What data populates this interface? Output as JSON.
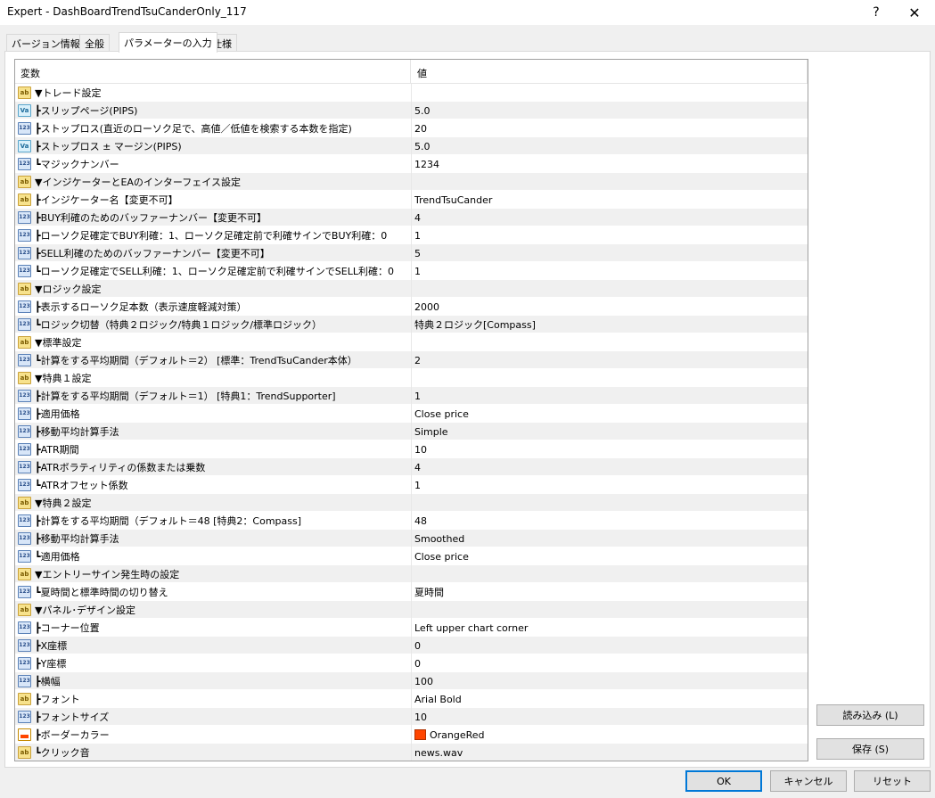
{
  "window": {
    "title": "Expert - DashBoardTrendTsuCanderOnly_117",
    "help_label": "?",
    "close_label": "✕"
  },
  "tabs": [
    {
      "label": "バージョン情報"
    },
    {
      "label": "全般"
    },
    {
      "label": "パラメーターの入力",
      "active": true
    },
    {
      "label": "仕様"
    }
  ],
  "grid": {
    "col_name": "変数",
    "col_value": "値",
    "rows": [
      {
        "icon": "ab",
        "name": "▼トレード設定",
        "value": ""
      },
      {
        "icon": "va",
        "name": "┣スリップページ(PIPS)",
        "value": "5.0"
      },
      {
        "icon": "123",
        "name": "┣ストップロス(直近のローソク足で、高値／低値を検索する本数を指定)",
        "value": "20"
      },
      {
        "icon": "va",
        "name": "┣ストップロス ± マージン(PIPS)",
        "value": "5.0"
      },
      {
        "icon": "123",
        "name": "┗マジックナンバー",
        "value": "1234"
      },
      {
        "icon": "ab",
        "name": "▼インジケーターとEAのインターフェイス設定",
        "value": ""
      },
      {
        "icon": "ab",
        "name": "┣インジケーター名【変更不可】",
        "value": "TrendTsuCander"
      },
      {
        "icon": "123",
        "name": "┣BUY利確のためのバッファーナンバー【変更不可】",
        "value": "4"
      },
      {
        "icon": "123",
        "name": "┣ローソク足確定でBUY利確：1、ローソク足確定前で利確サインでBUY利確：0",
        "value": "1"
      },
      {
        "icon": "123",
        "name": "┣SELL利確のためのバッファーナンバー【変更不可】",
        "value": "5"
      },
      {
        "icon": "123",
        "name": "┗ローソク足確定でSELL利確：1、ローソク足確定前で利確サインでSELL利確：0",
        "value": "1"
      },
      {
        "icon": "ab",
        "name": "▼ロジック設定",
        "value": ""
      },
      {
        "icon": "123",
        "name": "┣表示するローソク足本数（表示速度軽減対策）",
        "value": "2000"
      },
      {
        "icon": "123",
        "name": "┗ロジック切替（特典２ロジック/特典１ロジック/標準ロジック）",
        "value": "特典２ロジック[Compass]"
      },
      {
        "icon": "ab",
        "name": "▼標準設定",
        "value": ""
      },
      {
        "icon": "123",
        "name": "┗計算をする平均期間（デフォルト＝2） [標準：TrendTsuCander本体）",
        "value": "2"
      },
      {
        "icon": "ab",
        "name": "▼特典１設定",
        "value": ""
      },
      {
        "icon": "123",
        "name": "┣計算をする平均期間（デフォルト＝1） [特典1：TrendSupporter]",
        "value": "1"
      },
      {
        "icon": "123",
        "name": "┣適用価格",
        "value": "Close price"
      },
      {
        "icon": "123",
        "name": "┣移動平均計算手法",
        "value": "Simple"
      },
      {
        "icon": "123",
        "name": "┣ATR期間",
        "value": "10"
      },
      {
        "icon": "123",
        "name": "┣ATRボラティリティの係数または乗数",
        "value": "4"
      },
      {
        "icon": "123",
        "name": "┗ATRオフセット係数",
        "value": "1"
      },
      {
        "icon": "ab",
        "name": "▼特典２設定",
        "value": ""
      },
      {
        "icon": "123",
        "name": "┣計算をする平均期間（デフォルト＝48 [特典2：Compass]",
        "value": "48"
      },
      {
        "icon": "123",
        "name": "┣移動平均計算手法",
        "value": "Smoothed"
      },
      {
        "icon": "123",
        "name": "┗適用価格",
        "value": "Close price"
      },
      {
        "icon": "ab",
        "name": "▼エントリーサイン発生時の設定",
        "value": ""
      },
      {
        "icon": "123",
        "name": "┗夏時間と標準時間の切り替え",
        "value": "夏時間"
      },
      {
        "icon": "ab",
        "name": "▼パネル･デザイン設定",
        "value": ""
      },
      {
        "icon": "123",
        "name": "┣コーナー位置",
        "value": "Left upper chart corner"
      },
      {
        "icon": "123",
        "name": "┣X座標",
        "value": "0"
      },
      {
        "icon": "123",
        "name": "┣Y座標",
        "value": "0"
      },
      {
        "icon": "123",
        "name": "┣横幅",
        "value": "100"
      },
      {
        "icon": "ab",
        "name": "┣フォント",
        "value": "Arial Bold"
      },
      {
        "icon": "123",
        "name": "┣フォントサイズ",
        "value": "10"
      },
      {
        "icon": "color",
        "name": "┣ボーダーカラー",
        "value": "OrangeRed",
        "swatch": "#ff4500"
      },
      {
        "icon": "ab",
        "name": "┗クリック音",
        "value": "news.wav"
      }
    ]
  },
  "buttons": {
    "load": "読み込み (L)",
    "save": "保存 (S)",
    "ok": "OK",
    "cancel": "キャンセル",
    "reset": "リセット"
  },
  "icon_labels": {
    "ab": "ab",
    "va": "Va",
    "123": "123"
  },
  "colors": {
    "accent": "#0078d7",
    "swatch_orangered": "#ff4500",
    "alt_row": "#f0f0f0"
  }
}
